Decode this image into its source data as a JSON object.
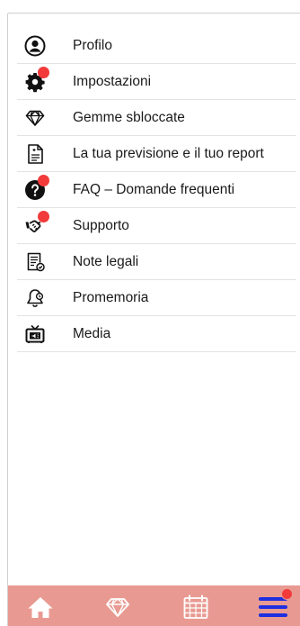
{
  "menu": {
    "items": [
      {
        "label": "Profilo",
        "icon": "user-circle-icon",
        "badge": false
      },
      {
        "label": "Impostazioni",
        "icon": "gear-icon",
        "badge": true
      },
      {
        "label": "Gemme sbloccate",
        "icon": "gem-icon",
        "badge": false
      },
      {
        "label": "La tua previsione e il tuo report",
        "icon": "document-icon",
        "badge": false
      },
      {
        "label": "FAQ – Domande frequenti",
        "icon": "question-circle-icon",
        "badge": true
      },
      {
        "label": "Supporto",
        "icon": "handshake-icon",
        "badge": true
      },
      {
        "label": "Note legali",
        "icon": "legal-document-icon",
        "badge": false
      },
      {
        "label": "Promemoria",
        "icon": "bell-icon",
        "badge": false
      },
      {
        "label": "Media",
        "icon": "tv-icon",
        "badge": false
      }
    ]
  },
  "tabbar": {
    "tabs": [
      {
        "icon": "home-icon",
        "badge": false
      },
      {
        "icon": "gem-icon",
        "badge": false
      },
      {
        "icon": "calendar-icon",
        "badge": false
      },
      {
        "icon": "menu-icon",
        "badge": true,
        "active": true
      }
    ],
    "background": "#e89a92",
    "active_color": "#1f2fe0"
  },
  "colors": {
    "badge": "#f23a3a",
    "divider": "#e3e3e3"
  }
}
